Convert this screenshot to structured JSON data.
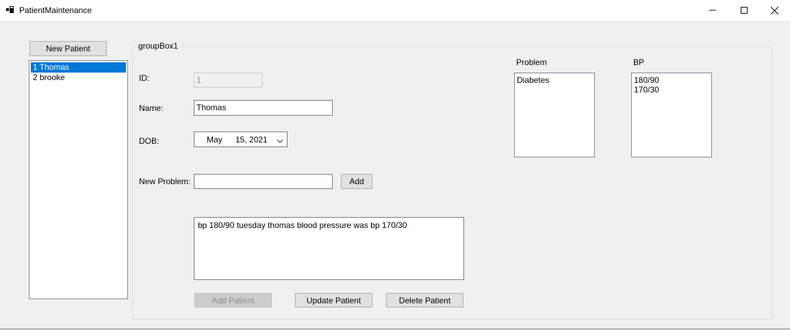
{
  "window": {
    "title": "PatientMaintenance"
  },
  "sidebar": {
    "new_patient_label": "New Patient",
    "patients": [
      {
        "label": "1 Thomas",
        "selected": true
      },
      {
        "label": "2 brooke",
        "selected": false
      }
    ]
  },
  "group": {
    "title": "groupBox1",
    "id_label": "ID:",
    "id_value": "1",
    "name_label": "Name:",
    "name_value": "Thomas",
    "dob_label": "DOB:",
    "dob_month": "May",
    "dob_day_year": "15, 2021",
    "new_problem_label": "New Problem:",
    "new_problem_value": "",
    "add_label": "Add",
    "notes_text": "bp 180/90 tuesday thomas blood pressure was bp 170/30",
    "add_patient_label": "Add Patient",
    "update_patient_label": "Update Patient",
    "delete_patient_label": "Delete Patient",
    "problem_header": "Problem",
    "problems": [
      "Diabetes"
    ],
    "bp_header": "BP",
    "bp_values": [
      "180/90",
      "170/30"
    ]
  },
  "colors": {
    "selection": "#0078d7",
    "window_bg": "#f0f0f0"
  }
}
